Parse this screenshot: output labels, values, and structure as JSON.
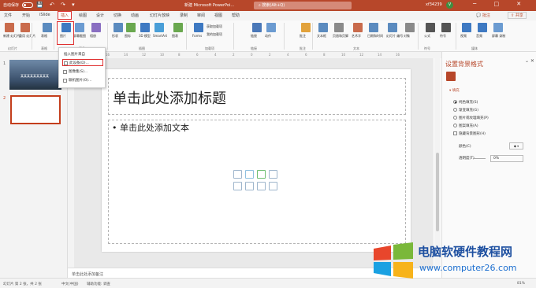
{
  "titlebar": {
    "autosave": "自动保存",
    "doc_title": "新建 Microsoft PowerPoi...",
    "search_placeholder": "搜索(Alt+Q)",
    "user": "xf34239",
    "avatar_initial": "V"
  },
  "tabs": [
    "文件",
    "开始",
    "iSlide",
    "插入",
    "绘图",
    "设计",
    "切换",
    "动画",
    "幻灯片放映",
    "录制",
    "审阅",
    "视图",
    "帮助"
  ],
  "active_tab": "插入",
  "comment_label": "批注",
  "share_label": "共享",
  "ribbon": {
    "buttons": [
      {
        "label": "新建\n幻灯片",
        "icon": "new-slide-icon"
      },
      {
        "label": "重用\n幻灯片",
        "icon": "reuse-slides-icon"
      },
      {
        "label": "表格",
        "icon": "table-icon"
      },
      {
        "label": "图片",
        "icon": "picture-icon"
      },
      {
        "label": "屏幕截图",
        "icon": "screenshot-icon"
      },
      {
        "label": "相册",
        "icon": "album-icon"
      },
      {
        "label": "形状",
        "icon": "shapes-icon"
      },
      {
        "label": "图标",
        "icon": "icons-icon"
      },
      {
        "label": "3D 模型",
        "icon": "3d-model-icon"
      },
      {
        "label": "SmartArt",
        "icon": "smartart-icon"
      },
      {
        "label": "图表",
        "icon": "chart-icon"
      },
      {
        "label": "Forms",
        "icon": "forms-icon"
      },
      {
        "label": "链接",
        "icon": "link-icon"
      },
      {
        "label": "动作",
        "icon": "action-icon"
      },
      {
        "label": "批注",
        "icon": "comment-icon"
      },
      {
        "label": "文本框",
        "icon": "textbox-icon"
      },
      {
        "label": "页眉和页脚",
        "icon": "header-footer-icon"
      },
      {
        "label": "艺术字",
        "icon": "wordart-icon"
      },
      {
        "label": "日期和时间",
        "icon": "datetime-icon"
      },
      {
        "label": "幻灯片\n编号",
        "icon": "slide-number-icon"
      },
      {
        "label": "对象",
        "icon": "object-icon"
      },
      {
        "label": "公式",
        "icon": "equation-icon"
      },
      {
        "label": "符号",
        "icon": "symbol-icon"
      },
      {
        "label": "视频",
        "icon": "video-icon"
      },
      {
        "label": "音频",
        "icon": "audio-icon"
      },
      {
        "label": "屏幕\n录制",
        "icon": "screen-record-icon"
      }
    ],
    "groups": [
      "幻灯片",
      "表格",
      "图像",
      "插图",
      "加载项",
      "链接",
      "批注",
      "文本",
      "符号",
      "媒体"
    ],
    "addins": [
      "获取加载项",
      "我的加载项"
    ]
  },
  "picture_menu": {
    "header": "插入图片来自",
    "items": [
      "此设备(D)...",
      "图像集(S)...",
      "联机图片(O)..."
    ]
  },
  "slides_panel": {
    "slide1_title": "某某某某某某某某某",
    "numbers": [
      "1",
      "2"
    ]
  },
  "slide": {
    "title_placeholder": "单击此处添加标题",
    "body_placeholder": "• 单击此处添加文本"
  },
  "notes_placeholder": "单击此处添加备注",
  "format_pane": {
    "title": "设置背景格式",
    "section": "填充",
    "options": [
      "纯色填充(S)",
      "渐变填充(G)",
      "图片或纹理填充(P)",
      "图案填充(A)"
    ],
    "hide_bg": "隐藏背景图形(H)",
    "color_label": "颜色(C)",
    "transparency_label": "透明度(T)",
    "transparency_value": "0%"
  },
  "status": {
    "slide_info": "幻灯片 第 2 张，共 2 张",
    "language": "中文(中国)",
    "accessibility": "辅助功能: 调查",
    "zoom": "81%"
  },
  "watermark": {
    "title": "电脑软硬件教程网",
    "url": "www.computer26.com"
  },
  "colors": {
    "accent": "#b7472a",
    "highlight": "#e03030"
  }
}
